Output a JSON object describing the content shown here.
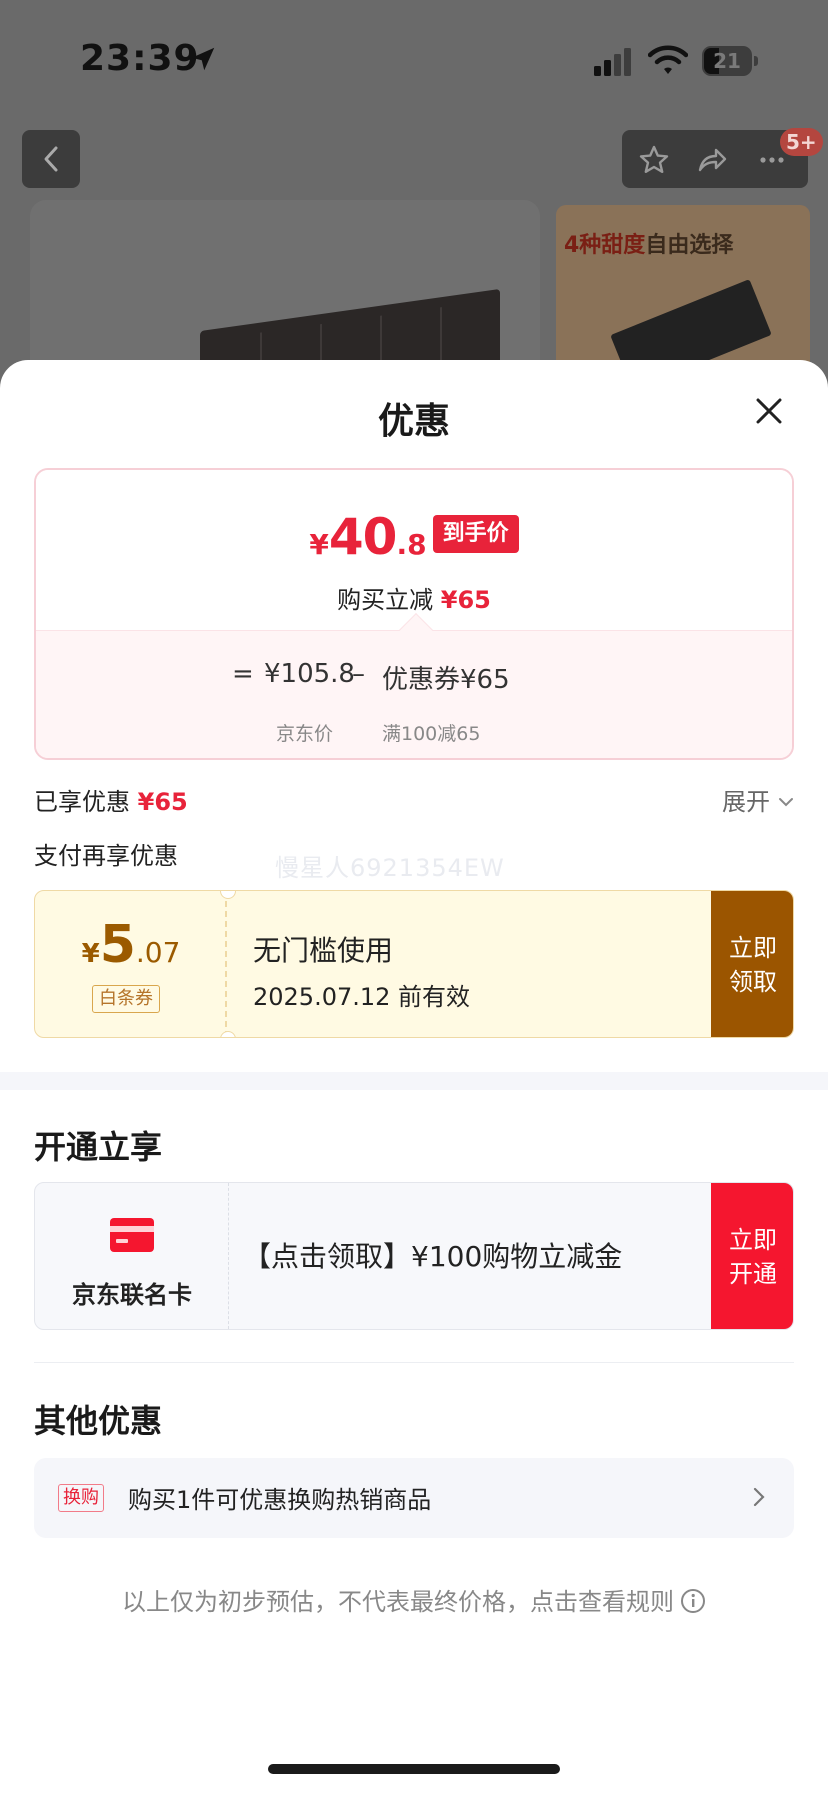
{
  "status_bar": {
    "time": "23:39",
    "battery": "21"
  },
  "background": {
    "badge": "5+",
    "thumb_text_highlight": "4种甜度",
    "thumb_text_rest": "自由选择"
  },
  "sheet": {
    "title": "优惠",
    "price_card": {
      "currency": "¥",
      "final_int": "40",
      "final_dec": ".8",
      "final_tag": "到手价",
      "saving_label": "购买立减",
      "saving_amount": "¥65",
      "equals": "=",
      "jd_price": "¥105.8",
      "minus": "–",
      "coupon_label": "优惠券¥65",
      "jd_price_label": "京东价",
      "coupon_rule": "满100减65"
    },
    "enjoyed": {
      "label": "已享优惠",
      "amount": "¥65",
      "expand": "展开"
    },
    "pay_more": "支付再享优惠",
    "watermark": "慢星人6921354EW",
    "coupon": {
      "currency": "¥",
      "int": "5",
      "dec": ".07",
      "type": "白条券",
      "desc": "无门槛使用",
      "valid": "2025.07.12 前有效",
      "button": "立即领取"
    },
    "open_section": {
      "title": "开通立享",
      "card_name": "京东联名卡",
      "desc": "【点击领取】¥100购物立减金",
      "button": "立即开通"
    },
    "other_section": {
      "title": "其他优惠",
      "tag": "换购",
      "text": "购买1件可优惠换购热销商品"
    },
    "disclaimer": "以上仅为初步预估，不代表最终价格，点击查看规则"
  },
  "colors": {
    "accent_red": "#e8233a",
    "coupon_brown": "#9b5500",
    "card_red": "#f5162f"
  }
}
